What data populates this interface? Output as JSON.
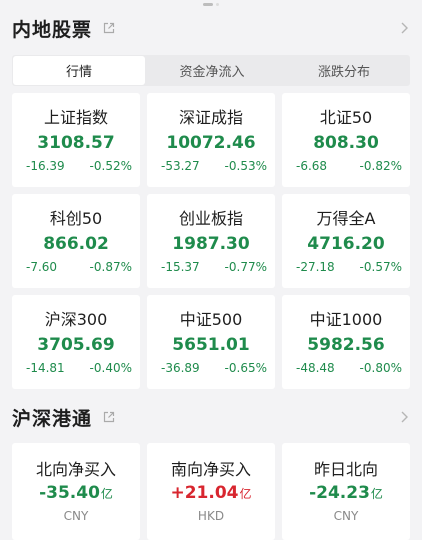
{
  "colors": {
    "down": "#1f8b4c",
    "up": "#d8262f"
  },
  "mainland": {
    "title": "内地股票",
    "tabs": [
      {
        "label": "行情",
        "active": true
      },
      {
        "label": "资金净流入",
        "active": false
      },
      {
        "label": "涨跌分布",
        "active": false
      }
    ],
    "indices": [
      {
        "name": "上证指数",
        "price": "3108.57",
        "change": "-16.39",
        "pct": "-0.52%"
      },
      {
        "name": "深证成指",
        "price": "10072.46",
        "change": "-53.27",
        "pct": "-0.53%"
      },
      {
        "name": "北证50",
        "price": "808.30",
        "change": "-6.68",
        "pct": "-0.82%"
      },
      {
        "name": "科创50",
        "price": "866.02",
        "change": "-7.60",
        "pct": "-0.87%"
      },
      {
        "name": "创业板指",
        "price": "1987.30",
        "change": "-15.37",
        "pct": "-0.77%"
      },
      {
        "name": "万得全A",
        "price": "4716.20",
        "change": "-27.18",
        "pct": "-0.57%"
      },
      {
        "name": "沪深300",
        "price": "3705.69",
        "change": "-14.81",
        "pct": "-0.40%"
      },
      {
        "name": "中证500",
        "price": "5651.01",
        "change": "-36.89",
        "pct": "-0.65%"
      },
      {
        "name": "中证1000",
        "price": "5982.56",
        "change": "-48.48",
        "pct": "-0.80%"
      }
    ]
  },
  "connect": {
    "title": "沪深港通",
    "flows": [
      {
        "name": "北向净买入",
        "value": "-35.40",
        "unit": "亿",
        "currency": "CNY",
        "direction": "down"
      },
      {
        "name": "南向净买入",
        "value": "+21.04",
        "unit": "亿",
        "currency": "HKD",
        "direction": "up"
      },
      {
        "name": "昨日北向",
        "value": "-24.23",
        "unit": "亿",
        "currency": "CNY",
        "direction": "down"
      }
    ]
  }
}
